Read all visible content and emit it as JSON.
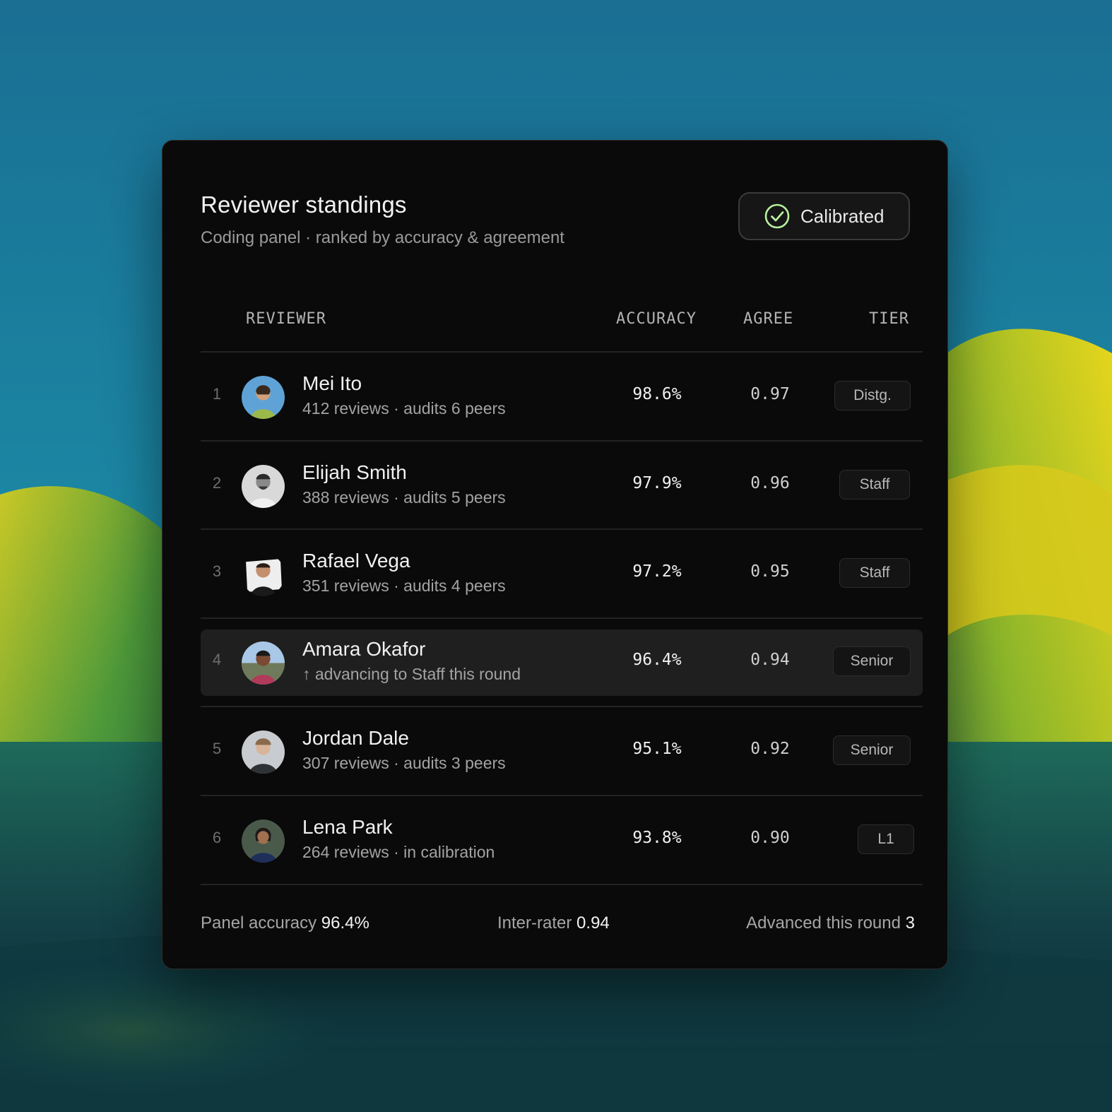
{
  "card": {
    "title": "Reviewer standings",
    "subtitle": "Coding panel · ranked by accuracy & agreement",
    "status_badge": {
      "label": "Calibrated",
      "icon": "check-circle-icon",
      "icon_color": "#b8f0a0"
    }
  },
  "table": {
    "headers": {
      "reviewer": "REVIEWER",
      "accuracy": "ACCURACY",
      "agree": "AGREE",
      "tier": "TIER"
    },
    "rows": [
      {
        "rank": "1",
        "name": "Mei Ito",
        "meta": "412 reviews · audits 6 peers",
        "accuracy": "98.6%",
        "agree": "0.97",
        "tier": "Distg.",
        "highlighted": false
      },
      {
        "rank": "2",
        "name": "Elijah Smith",
        "meta": "388 reviews · audits 5 peers",
        "accuracy": "97.9%",
        "agree": "0.96",
        "tier": "Staff",
        "highlighted": false
      },
      {
        "rank": "3",
        "name": "Rafael Vega",
        "meta": "351 reviews · audits 4 peers",
        "accuracy": "97.2%",
        "agree": "0.95",
        "tier": "Staff",
        "highlighted": false
      },
      {
        "rank": "4",
        "name": "Amara Okafor",
        "meta": "↑ advancing to Staff this round",
        "accuracy": "96.4%",
        "agree": "0.94",
        "tier": "Senior",
        "highlighted": true
      },
      {
        "rank": "5",
        "name": "Jordan Dale",
        "meta": "307 reviews · audits 3 peers",
        "accuracy": "95.1%",
        "agree": "0.92",
        "tier": "Senior",
        "highlighted": false
      },
      {
        "rank": "6",
        "name": "Lena Park",
        "meta": "264 reviews · in calibration",
        "accuracy": "93.8%",
        "agree": "0.90",
        "tier": "L1",
        "highlighted": false
      }
    ]
  },
  "footer": {
    "panel_accuracy_label": "Panel accuracy",
    "panel_accuracy_value": "96.4%",
    "inter_rater_label": "Inter-rater",
    "inter_rater_value": "0.94",
    "advanced_label": "Advanced this round",
    "advanced_value": "3"
  },
  "colors": {
    "card_background": "#0a0a0a",
    "highlight_row": "#1f1f1f",
    "accent_check": "#b8f0a0",
    "sky": "#1a7a9c",
    "hills_yellow": "#d8d01a",
    "hills_green": "#1f6b4a"
  }
}
